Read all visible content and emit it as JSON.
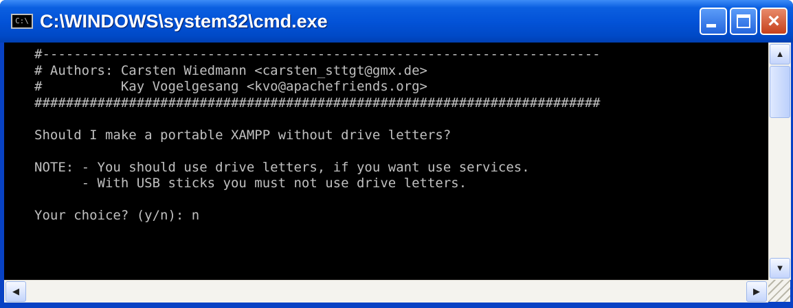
{
  "window": {
    "title": "C:\\WINDOWS\\system32\\cmd.exe",
    "icon_label": "C:\\"
  },
  "titlebar_buttons": {
    "minimize": "_",
    "maximize": "□",
    "close": "×"
  },
  "console": {
    "text": "#-----------------------------------------------------------------------\n# Authors: Carsten Wiedmann <carsten_sttgt@gmx.de>\n#          Kay Vogelgesang <kvo@apachefriends.org>\n########################################################################\n\nShould I make a portable XAMPP without drive letters?\n\nNOTE: - You should use drive letters, if you want use services.\n      - With USB sticks you must not use drive letters.\n\nYour choice? (y/n): n"
  },
  "scrollbars": {
    "up_arrow": "▲",
    "down_arrow": "▼",
    "left_arrow": "◀",
    "right_arrow": "▶"
  },
  "colors": {
    "titlebar": "#0353d8",
    "console_bg": "#000000",
    "console_fg": "#c0c0c0",
    "close_button": "#c6411c"
  }
}
